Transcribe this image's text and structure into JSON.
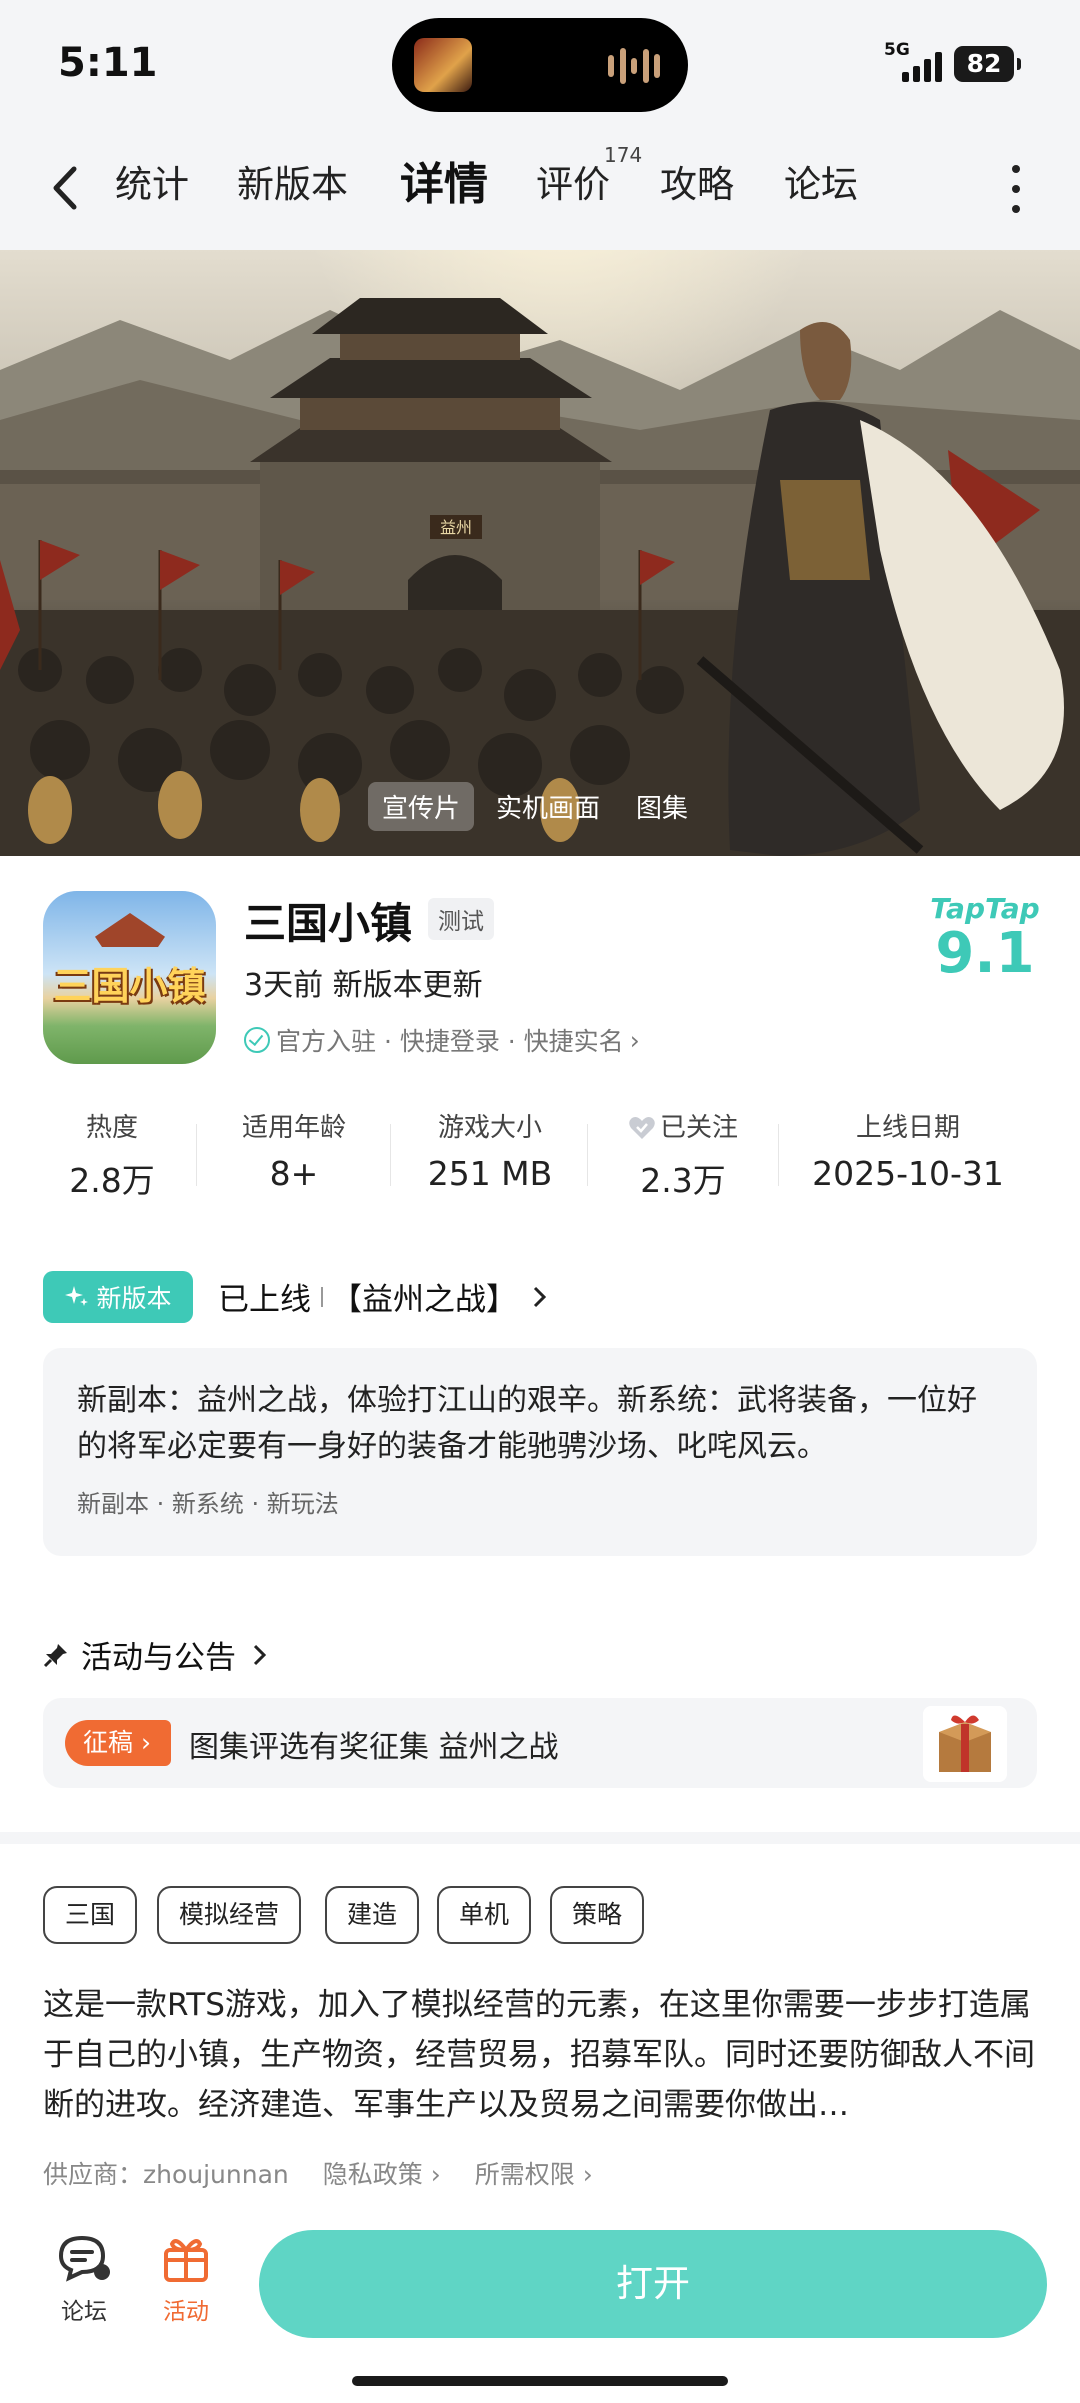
{
  "status": {
    "time": "5:11",
    "network": "5G",
    "battery": "82"
  },
  "nav": {
    "tabs": [
      {
        "label": "统计"
      },
      {
        "label": "新版本"
      },
      {
        "label": "详情"
      },
      {
        "label": "评价",
        "sup": "174"
      },
      {
        "label": "攻略"
      },
      {
        "label": "论坛"
      }
    ],
    "active": "详情"
  },
  "hero": {
    "gate_sign": "益州",
    "media_tabs": [
      "宣传片",
      "实机画面",
      "图集"
    ]
  },
  "app": {
    "name": "三国小镇",
    "icon_text": "三国小镇",
    "badge": "测试",
    "update": "3天前 新版本更新",
    "official": "官方入驻 · 快捷登录 · 快捷实名",
    "rating_brand": "TapTap",
    "rating": "9.1"
  },
  "stats": [
    {
      "label": "热度",
      "value": "2.8万"
    },
    {
      "label": "适用年龄",
      "value": "8+"
    },
    {
      "label": "游戏大小",
      "value": "251 MB"
    },
    {
      "label": "已关注",
      "value": "2.3万"
    },
    {
      "label": "上线日期",
      "value": "2025-10-31"
    }
  ],
  "new_version": {
    "tag": "新版本",
    "status": "已上线",
    "title": "【益州之战】",
    "desc": "新副本：益州之战，体验打江山的艰辛。新系统：武将装备，一位好的将军必定要有一身好的装备才能驰骋沙场、叱咤风云。",
    "tags": "新副本 · 新系统 · 新玩法"
  },
  "activity": {
    "title": "活动与公告",
    "label": "征稿",
    "text": "图集评选有奖征集 益州之战"
  },
  "genres": [
    "三国",
    "模拟经营",
    "建造",
    "单机",
    "策略"
  ],
  "intro": "这是一款RTS游戏，加入了模拟经营的元素，在这里你需要一步步打造属于自己的小镇，生产物资，经营贸易，招募军队。同时还要防御敌人不间断的进攻。经济建造、军事生产以及贸易之间需要你做出…",
  "meta": {
    "supplier": "供应商：zhoujunnan",
    "privacy": "隐私政策",
    "permissions": "所需权限"
  },
  "bottom": {
    "forum": "论坛",
    "activity": "活动",
    "open": "打开"
  },
  "colors": {
    "accent": "#3ec9b7",
    "open_button": "#5fd5c5",
    "orange": "#f06b33"
  }
}
